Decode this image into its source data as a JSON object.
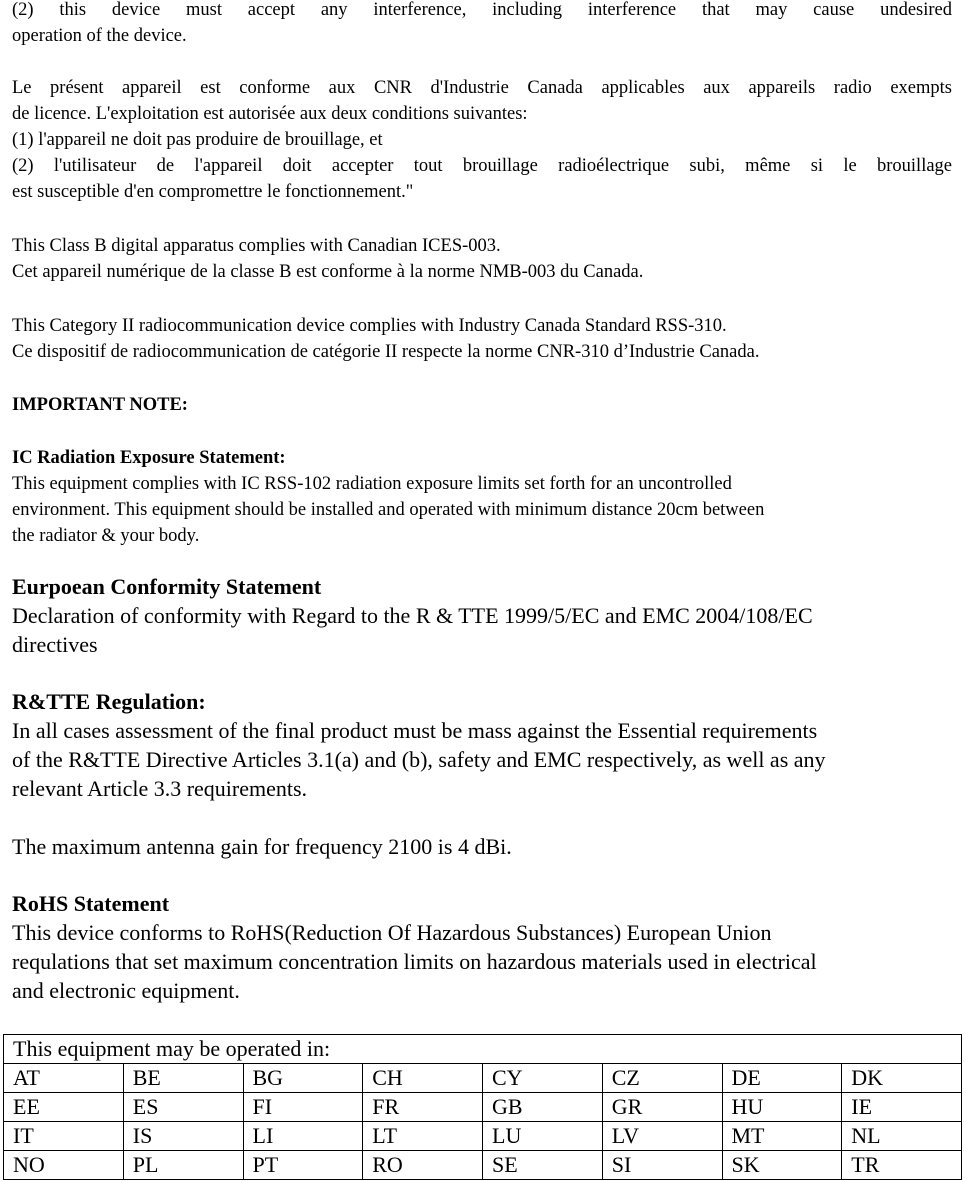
{
  "fcc_tail": {
    "line1": "(2) this device must accept any interference, including interference that may cause undesired",
    "line2": "operation of the device."
  },
  "ic_french": {
    "line1": "Le présent appareil est conforme aux CNR d'Industrie Canada applicables aux appareils radio exempts",
    "line2": "de licence. L'exploitation est autorisée aux deux conditions suivantes:",
    "line3": "(1) l'appareil ne doit pas produire de brouillage, et",
    "line4": "(2) l'utilisateur de l'appareil doit accepter tout brouillage radioélectrique subi, même si le brouillage",
    "line5": "est susceptible d'en compromettre le fonctionnement.\""
  },
  "ices": {
    "line1": "This Class B digital apparatus complies with Canadian ICES-003.",
    "line2": "Cet appareil numérique de la classe B est conforme à la norme NMB-003 du Canada."
  },
  "rss310": {
    "line1": "This Category II radiocommunication device complies with Industry Canada Standard RSS-310.",
    "line2": "Ce dispositif de radiocommunication de catégorie II respecte la norme CNR-310 d’Industrie Canada."
  },
  "important_note": "IMPORTANT NOTE:",
  "ic_radiation": {
    "heading": "IC Radiation Exposure Statement:",
    "line1": "This equipment complies with IC RSS-102 radiation exposure limits set forth for an uncontrolled",
    "line2": "environment. This equipment should be installed and operated with minimum distance 20cm between",
    "line3": "the radiator & your body."
  },
  "eu_conformity": {
    "heading": "Eurpoean Conformity Statement",
    "line1": "Declaration of conformity with Regard to the R & TTE 1999/5/EC and EMC 2004/108/EC",
    "line2": "directives"
  },
  "rtte": {
    "heading": "R&TTE Regulation:",
    "line1": "In all cases assessment of the final product must be mass against the Essential requirements",
    "line2": "of the R&TTE Directive Articles 3.1(a) and (b), safety and EMC respectively, as well as any",
    "line3": "relevant Article 3.3 requirements."
  },
  "antenna_gain": "The maximum antenna gain for frequency 2100 is 4 dBi.",
  "rohs": {
    "heading": "RoHS Statement",
    "line1": "This device conforms to RoHS(Reduction Of Hazardous Substances) European Union",
    "line2": "requlations that set maximum concentration limits on hazardous materials used in electrical",
    "line3": "and electronic equipment."
  },
  "countries_table": {
    "header": "This equipment may be operated in:",
    "rows": [
      [
        "AT",
        "BE",
        "BG",
        "CH",
        "CY",
        "CZ",
        "DE",
        "DK"
      ],
      [
        "EE",
        "ES",
        "FI",
        "FR",
        "GB",
        "GR",
        "HU",
        "IE"
      ],
      [
        "IT",
        "IS",
        "LI",
        "LT",
        "LU",
        "LV",
        "MT",
        "NL"
      ],
      [
        "NO",
        "PL",
        "PT",
        "RO",
        "SE",
        "SI",
        "SK",
        "TR"
      ]
    ]
  }
}
